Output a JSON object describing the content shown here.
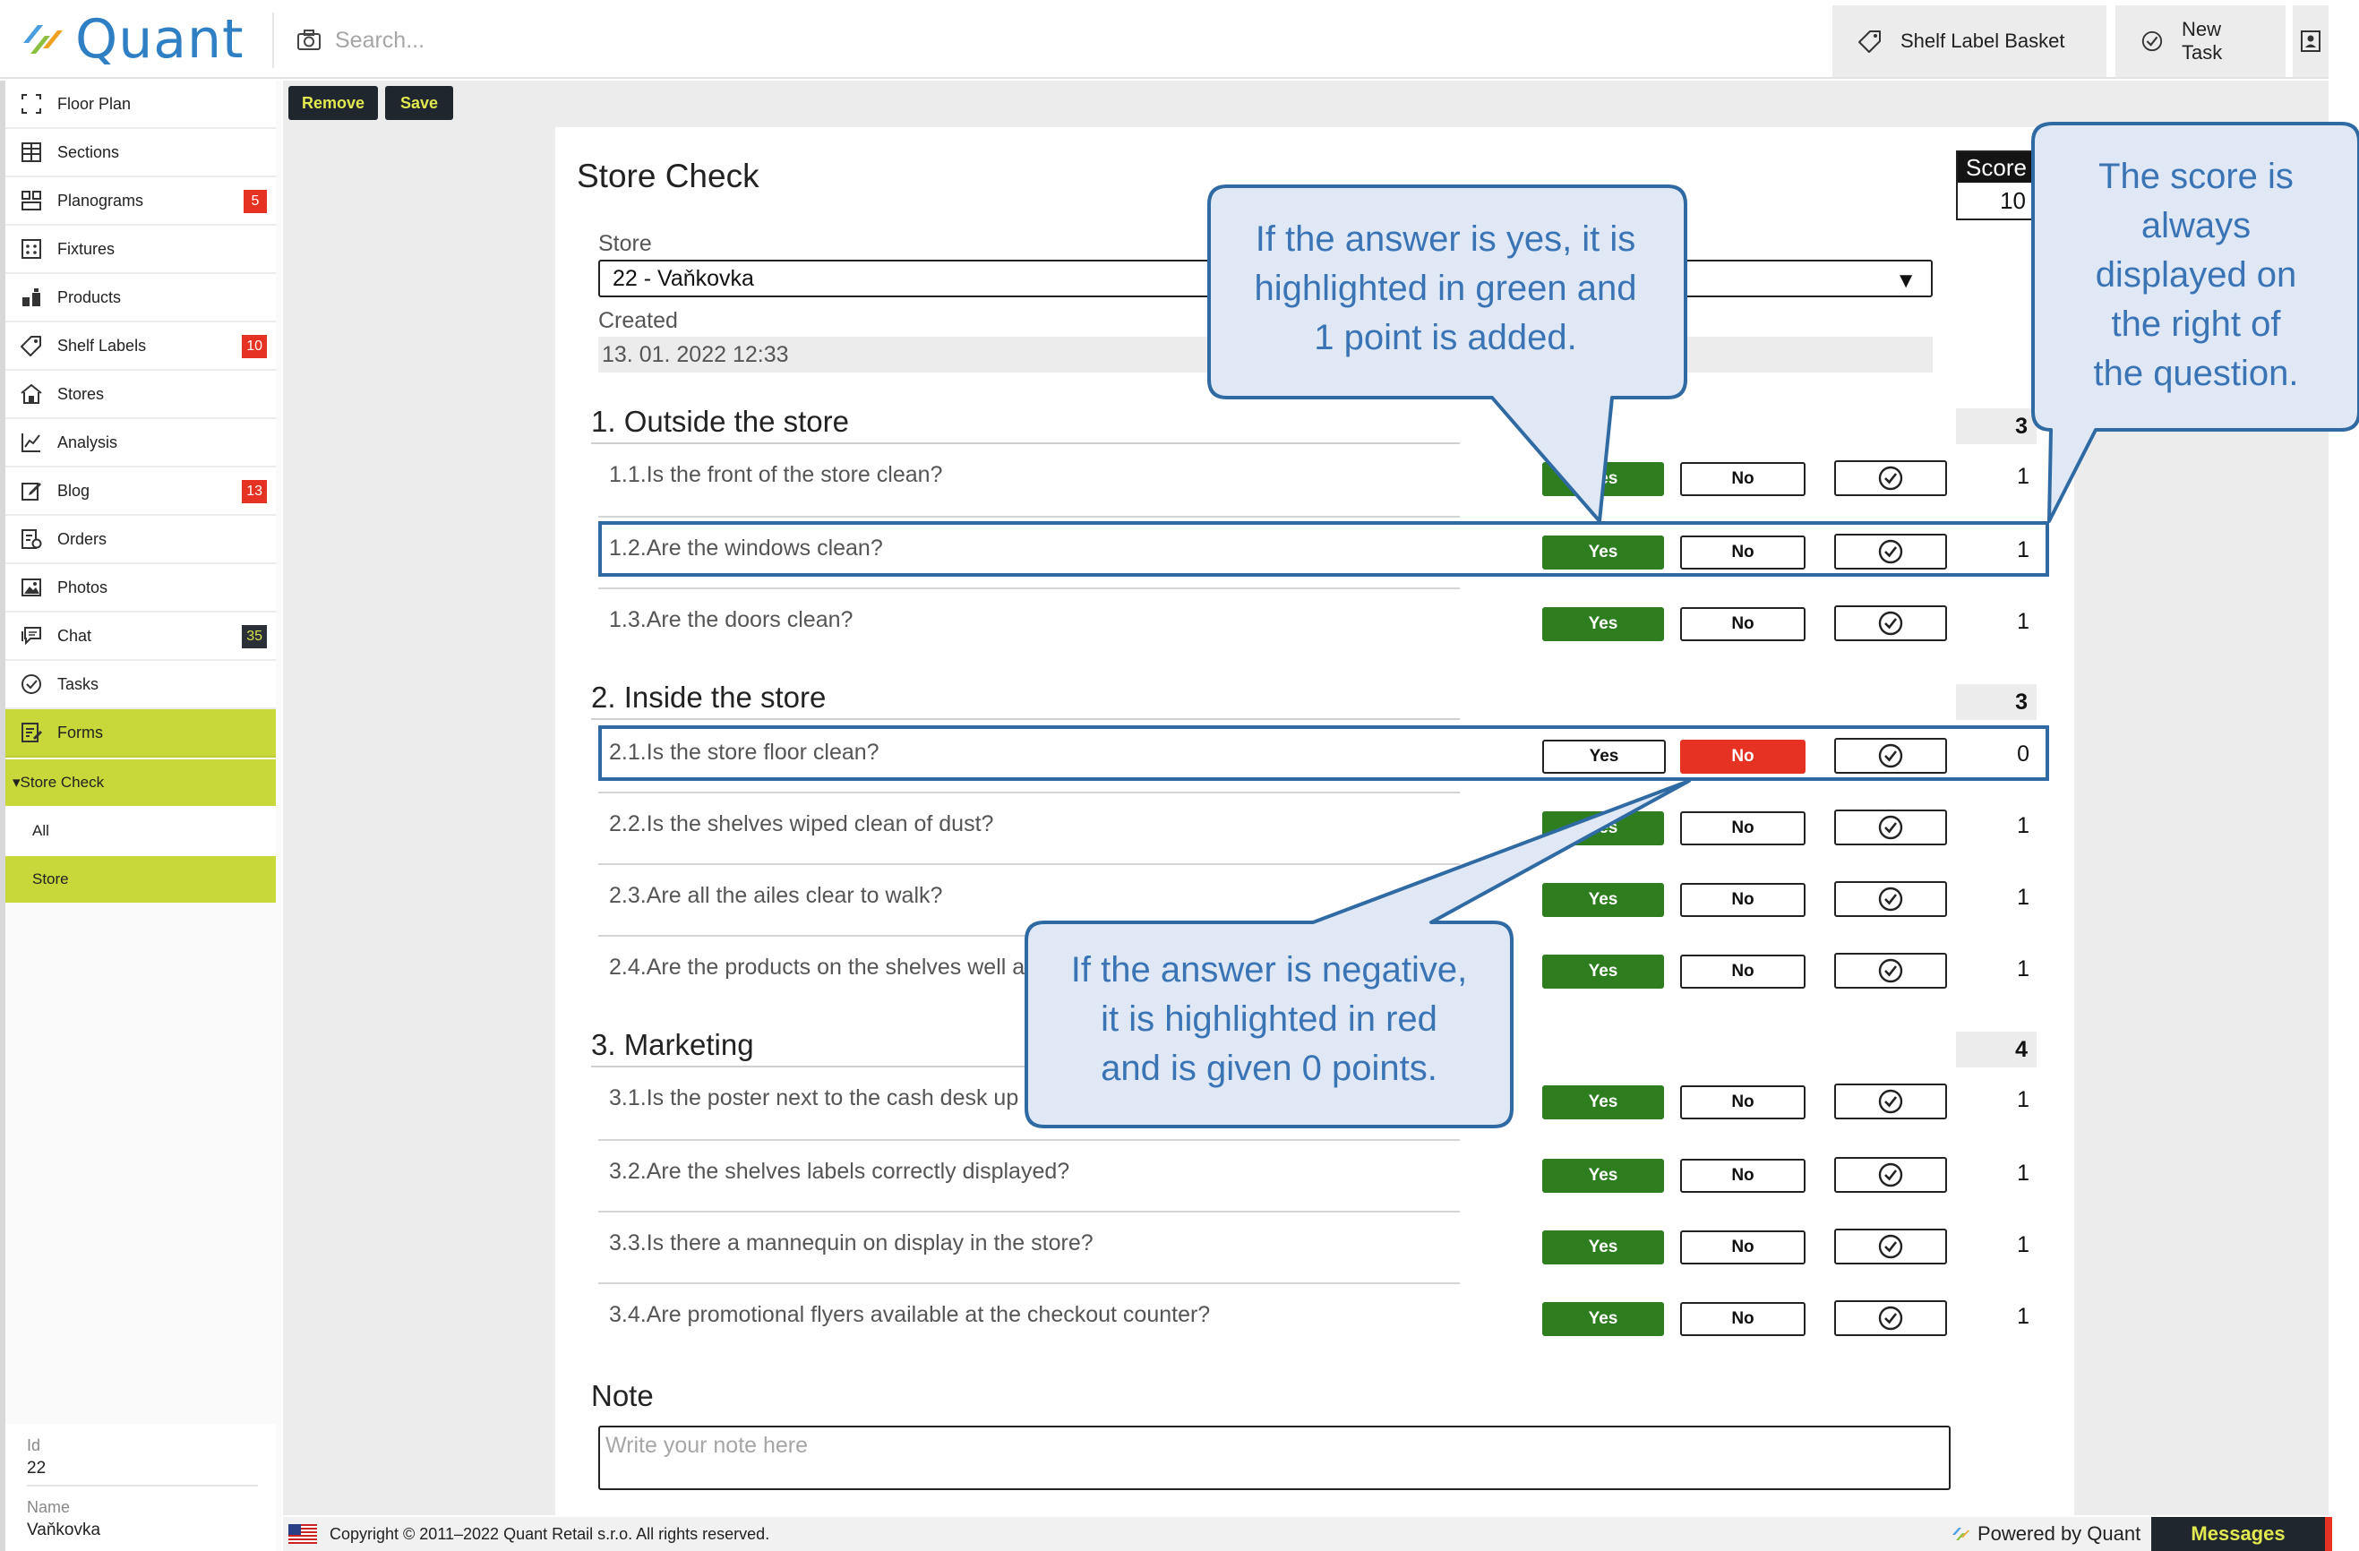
{
  "app": {
    "name": "Quant"
  },
  "search": {
    "placeholder": "Search..."
  },
  "header": {
    "shelf_basket": "Shelf Label Basket",
    "new_task": "New Task"
  },
  "sidebar": {
    "items": [
      {
        "label": "Floor Plan",
        "icon": "floor-plan-icon"
      },
      {
        "label": "Sections",
        "icon": "sections-icon"
      },
      {
        "label": "Planograms",
        "icon": "planograms-icon",
        "badge": "5"
      },
      {
        "label": "Fixtures",
        "icon": "fixtures-icon"
      },
      {
        "label": "Products",
        "icon": "products-icon"
      },
      {
        "label": "Shelf Labels",
        "icon": "tag-icon",
        "badge": "10"
      },
      {
        "label": "Stores",
        "icon": "store-icon"
      },
      {
        "label": "Analysis",
        "icon": "chart-icon"
      },
      {
        "label": "Blog",
        "icon": "edit-icon",
        "badge": "13"
      },
      {
        "label": "Orders",
        "icon": "orders-icon"
      },
      {
        "label": "Photos",
        "icon": "photo-icon"
      },
      {
        "label": "Chat",
        "icon": "chat-icon",
        "badge": "35"
      },
      {
        "label": "Tasks",
        "icon": "check-circle-icon"
      },
      {
        "label": "Forms",
        "icon": "forms-icon"
      }
    ],
    "submenu": {
      "title": "▾Store Check",
      "items": [
        "All",
        "Store"
      ]
    },
    "meta": {
      "id_label": "Id",
      "id_value": "22",
      "name_label": "Name",
      "name_value": "Vaňkovka"
    }
  },
  "toolbar": {
    "remove": "Remove",
    "save": "Save"
  },
  "form": {
    "title": "Store Check",
    "store_label": "Store",
    "store_value": "22 - Vaňkovka",
    "created_label": "Created",
    "created_value": "13. 01. 2022 12:33",
    "score_label": "Score",
    "score_value": "10",
    "yes_label": "Yes",
    "no_label": "No",
    "sections": [
      {
        "title": "1. Outside the store",
        "score": "3",
        "questions": [
          {
            "text": "1.1.Is the front of the store clean?",
            "answer": "yes",
            "score": "1"
          },
          {
            "text": "1.2.Are the windows clean?",
            "answer": "yes",
            "score": "1"
          },
          {
            "text": "1.3.Are the doors clean?",
            "answer": "yes",
            "score": "1"
          }
        ]
      },
      {
        "title": "2. Inside the store",
        "score": "3",
        "questions": [
          {
            "text": "2.1.Is the store floor clean?",
            "answer": "no",
            "score": "0"
          },
          {
            "text": "2.2.Is the shelves wiped clean of dust?",
            "answer": "yes",
            "score": "1"
          },
          {
            "text": "2.3.Are all the ailes clear to walk?",
            "answer": "yes",
            "score": "1"
          },
          {
            "text": "2.4.Are the products on the shelves well arranged?",
            "answer": "yes",
            "score": "1"
          }
        ]
      },
      {
        "title": "3. Marketing",
        "score": "4",
        "questions": [
          {
            "text": "3.1.Is the poster next to the cash desk up to date?",
            "answer": "yes",
            "score": "1"
          },
          {
            "text": "3.2.Are the shelves labels correctly displayed?",
            "answer": "yes",
            "score": "1"
          },
          {
            "text": "3.3.Is there a mannequin on display in the store?",
            "answer": "yes",
            "score": "1"
          },
          {
            "text": "3.4.Are promotional flyers available at the checkout counter?",
            "answer": "yes",
            "score": "1"
          }
        ]
      }
    ],
    "note_title": "Note",
    "note_placeholder": "Write your note here"
  },
  "footer": {
    "copyright": "Copyright © 2011–2022 Quant Retail s.r.o. All rights reserved.",
    "powered": "Powered by Quant",
    "messages": "Messages"
  },
  "callouts": {
    "yes": [
      "If the answer is yes, it is",
      "highlighted in green and",
      "1 point is added."
    ],
    "score": [
      "The score is",
      "always",
      "displayed on",
      "the right of",
      "the question."
    ],
    "negative": [
      "If the answer is negative,",
      "it is highlighted in red",
      "and is given 0 points."
    ]
  },
  "colors": {
    "accent": "#c8d73a",
    "brand": "#2f7fc4",
    "yes": "#2e7d1f",
    "no": "#e63222",
    "callout": "#3a74b5"
  }
}
